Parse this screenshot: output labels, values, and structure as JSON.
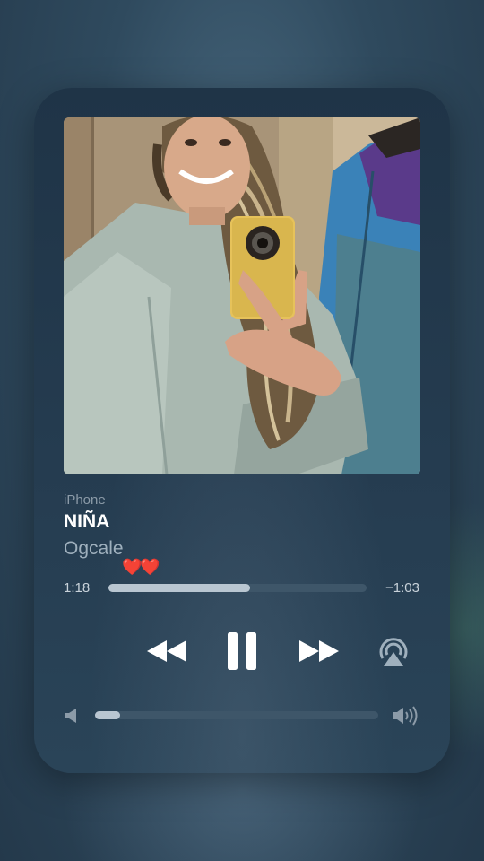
{
  "player": {
    "source_label": "iPhone",
    "track_title": "NIÑA",
    "artist": "Ogcale",
    "hearts": "❤️❤️",
    "elapsed": "1:18",
    "remaining": "−1:03",
    "progress_fraction": 0.55,
    "volume_fraction": 0.09
  },
  "controls": {
    "rewind_icon": "backward-icon",
    "pause_icon": "pause-icon",
    "forward_icon": "forward-icon",
    "airplay_icon": "airplay-icon",
    "volume_low_icon": "speaker-low-icon",
    "volume_high_icon": "speaker-high-icon"
  },
  "colors": {
    "accent": "#b9c6d1",
    "card": "#243a4e",
    "title": "#ffffff"
  }
}
